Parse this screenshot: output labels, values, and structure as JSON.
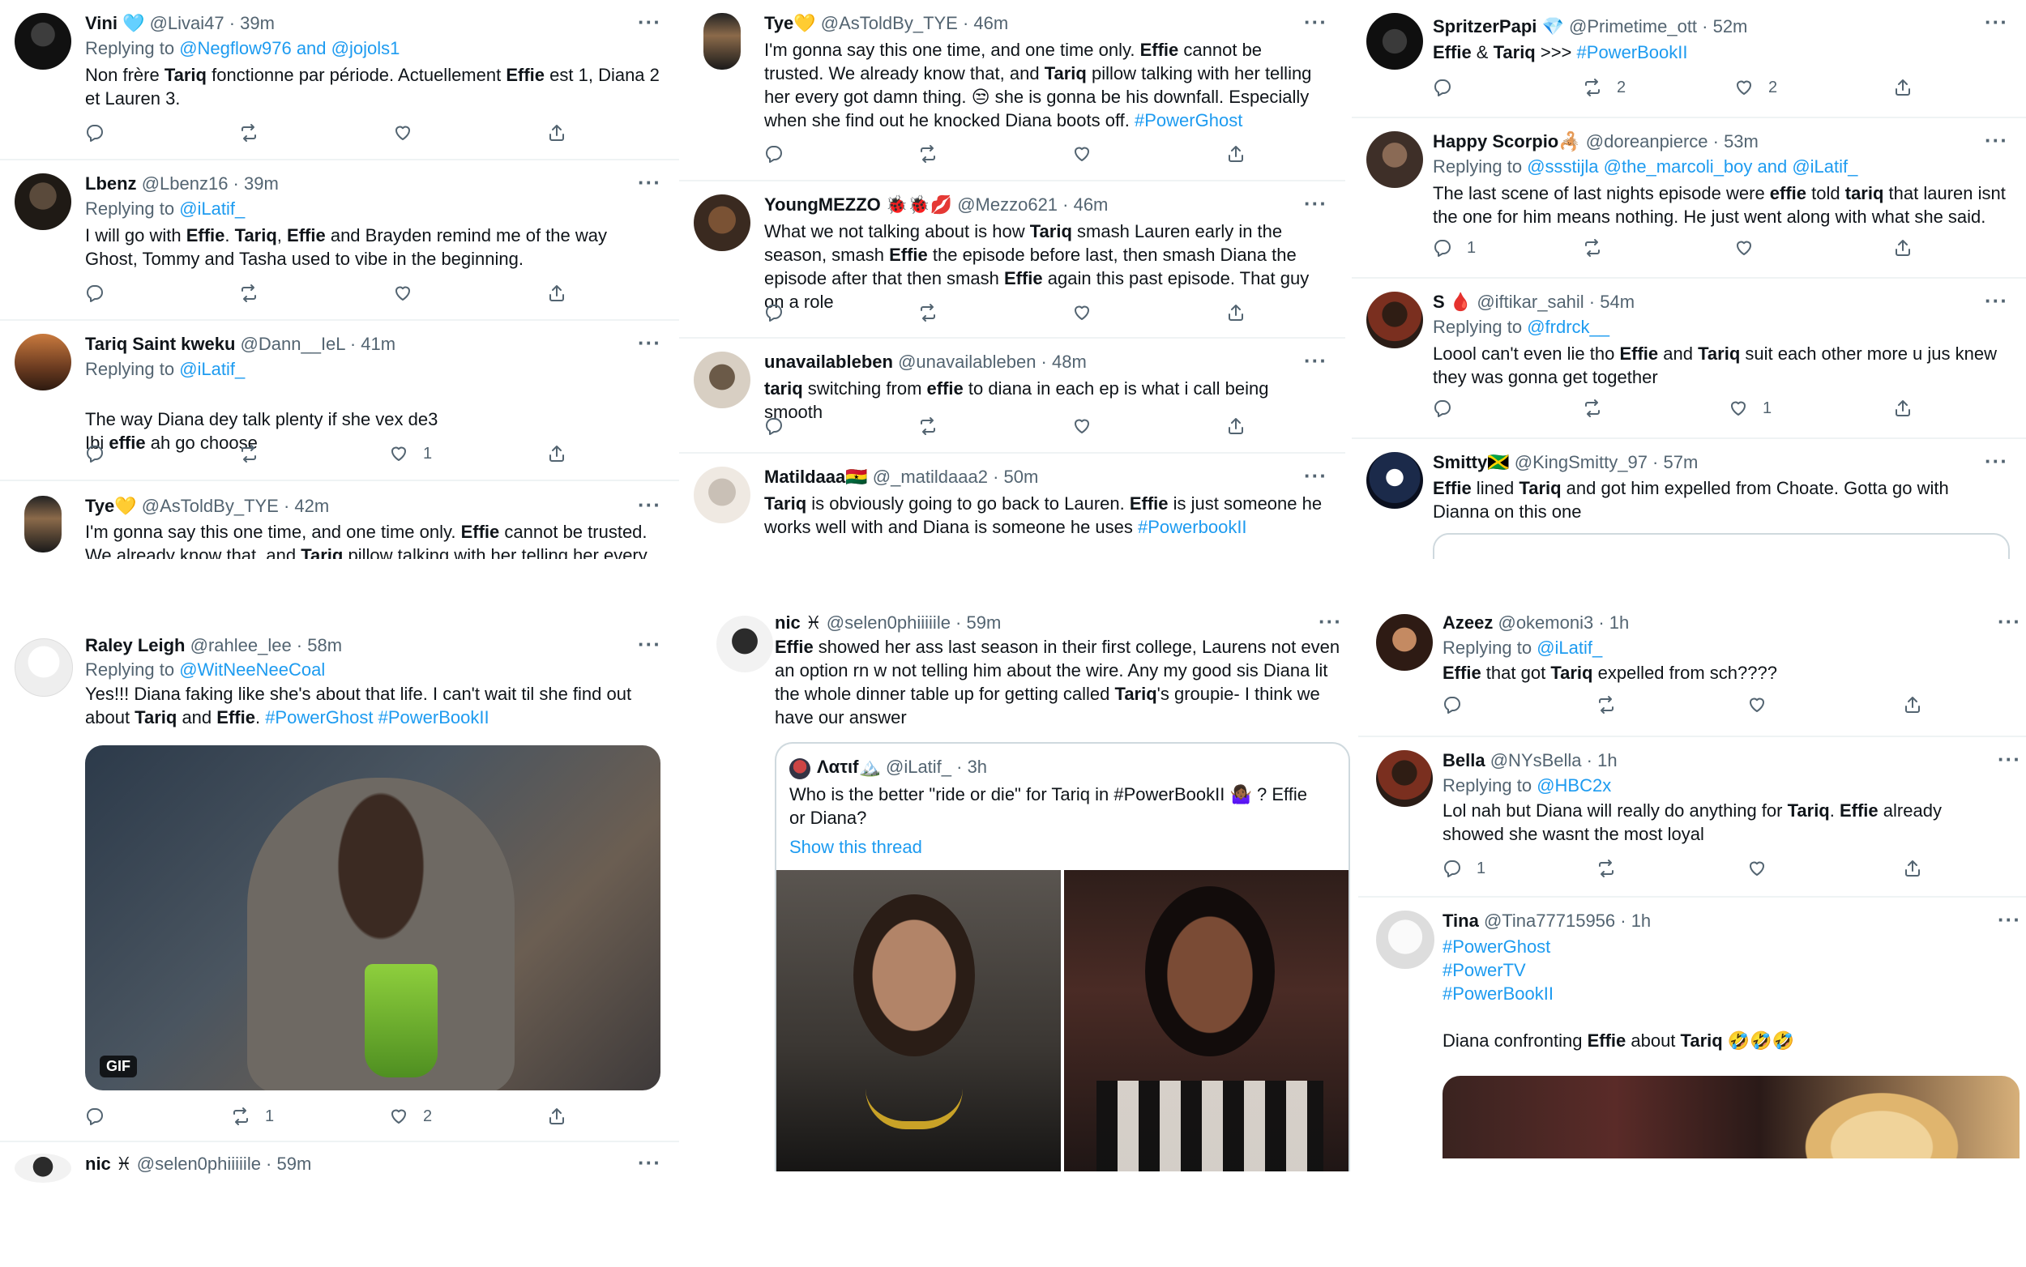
{
  "panels": {
    "p1": {
      "tweets": [
        {
          "name": "Vini 🩵",
          "handle": "@Livai47 · 39m",
          "reply_prefix": "Replying to ",
          "reply_to": "@Negflow976 and @jojols1",
          "text_parts": [
            "Non frère ",
            "Tariq",
            " fonctionne par période. Actuellement ",
            "Effie",
            " est 1, Diana 2 et Lauren 3."
          ],
          "likes": ""
        },
        {
          "name": "Lbenz",
          "handle": "@Lbenz16 · 39m",
          "reply_prefix": "Replying to ",
          "reply_to": "@iLatif_",
          "text_parts": [
            "I will go with ",
            "Effie",
            ".  ",
            "Tariq",
            ", ",
            "Effie",
            " and Brayden remind me of the way Ghost, Tommy and Tasha used to vibe in the beginning."
          ],
          "likes": ""
        },
        {
          "name": "Tariq Saint kweku",
          "handle": "@Dann__IeL · 41m",
          "reply_prefix": "Replying to ",
          "reply_to": "@iLatif_",
          "text_parts": [
            "The way Diana dey talk plenty if she vex de3\nIbi ",
            "effie",
            " ah go choose"
          ],
          "likes": "1"
        },
        {
          "name": "Tye💛",
          "handle": "@AsToldBy_TYE · 42m",
          "text_parts": [
            "I'm gonna say this one time, and one time only. ",
            "Effie",
            " cannot be trusted. We already know that, and ",
            "Tariq",
            " pillow talking with her telling her every got"
          ]
        }
      ]
    },
    "p2": {
      "tweets": [
        {
          "name": "Tye💛",
          "handle": "@AsToldBy_TYE · 46m",
          "text_parts": [
            "I'm gonna say this one time, and one time only. ",
            "Effie",
            " cannot be trusted. We already know that, and ",
            "Tariq",
            " pillow talking with her telling her every got damn thing. 😒 she is gonna be his downfall. Especially when she find out he knocked Diana boots off. "
          ],
          "hashtag": "#PowerGhost"
        },
        {
          "name": "YoungMEZZO 🐞🐞💋",
          "handle": "@Mezzo621 · 46m",
          "text_parts": [
            "What we not talking about is how ",
            "Tariq",
            " smash Lauren early in the season, smash ",
            "Effie",
            " the episode before last, then smash Diana the episode after that then smash ",
            "Effie",
            " again this past episode. That guy on a role"
          ]
        },
        {
          "name": "unavailableben",
          "handle": "@unavailableben · 48m",
          "text_parts": [
            "tariq",
            " switching from ",
            "effie",
            " to diana in each ep is what i call being smooth"
          ]
        },
        {
          "name": "Matildaaa🇬🇭",
          "handle": "@_matildaaa2 · 50m",
          "text_parts": [
            "Tariq",
            " is obviously going to go back to Lauren. ",
            "Effie",
            " is just someone he works well with and Diana is someone he uses "
          ],
          "hashtag": "#PowerbookII"
        }
      ]
    },
    "p3": {
      "tweets": [
        {
          "name": "SpritzerPapi 💎",
          "handle": "@Primetime_ott · 52m",
          "text_parts": [
            "Effie",
            " & ",
            "Tariq",
            " >>> "
          ],
          "hashtag": "#PowerBookII",
          "retweets": "2",
          "likes": "2"
        },
        {
          "name": "Happy Scorpio🦂",
          "handle": "@doreanpierce · 53m",
          "reply_prefix": "Replying to ",
          "reply_to": "@ssstijla @the_marcoli_boy and @iLatif_",
          "text_parts": [
            "The last scene of last nights episode were ",
            "effie",
            " told ",
            "tariq",
            " that lauren isnt the one for him means nothing. He just went along with what she said."
          ],
          "replies": "1"
        },
        {
          "name": "S 🩸",
          "handle": "@iftikar_sahil · 54m",
          "reply_prefix": "Replying to ",
          "reply_to": "@frdrck__",
          "text_parts": [
            "Loool can't even lie tho ",
            "Effie",
            " and ",
            "Tariq",
            " suit each other more u jus knew they was gonna get together"
          ],
          "likes": "1"
        },
        {
          "name": "Smitty🇯🇲",
          "handle": "@KingSmitty_97 · 57m",
          "text_parts": [
            "Effie",
            " lined ",
            "Tariq",
            " and got him expelled from Choate. Gotta go with Dianna on this one"
          ]
        }
      ]
    },
    "p4": {
      "tweets": [
        {
          "name": "Raley Leigh",
          "handle": "@rahlee_lee · 58m",
          "reply_prefix": "Replying to ",
          "reply_to": "@WitNeeNeeCoal",
          "text_parts": [
            "Yes!!! Diana faking like she's about that life. I can't wait til she find out about ",
            "Tariq",
            " and ",
            "Effie",
            ". "
          ],
          "hashtag": "#PowerGhost",
          "hashtag2": "#PowerBookII",
          "gif_label": "GIF",
          "retweets": "1",
          "likes": "2"
        },
        {
          "name": "nic ♓︎",
          "handle": "@selen0phiiiiile · 59m"
        }
      ]
    },
    "p5": {
      "tweet": {
        "name": "nic ♓︎",
        "handle": "@selen0phiiiiile · 59m",
        "text_parts": [
          "Effie",
          " showed her ass last season in their first college, Laurens not even an option rn w not telling him about the wire. Any my good sis Diana lit the whole dinner table up for getting called ",
          "Tariq",
          "'s groupie- I think we have our answer"
        ]
      },
      "quote": {
        "name": "Λατιf🏔️",
        "handle": "@iLatif_ · 3h",
        "text": "Who is the better \"ride or die\" for Tariq in #PowerBookII 🤷🏾‍♀️ ? Effie or Diana?",
        "link": "Show this thread"
      }
    },
    "p6": {
      "tweets": [
        {
          "name": "Azeez",
          "handle": "@okemoni3 · 1h",
          "reply_prefix": "Replying to ",
          "reply_to": "@iLatif_",
          "text_parts": [
            "Effie",
            " that got ",
            "Tariq",
            " expelled from sch????"
          ]
        },
        {
          "name": "Bella",
          "handle": "@NYsBella · 1h",
          "reply_prefix": "Replying to ",
          "reply_to": "@HBC2x",
          "text_parts": [
            "Lol nah but Diana will really do anything for ",
            "Tariq",
            ". ",
            "Effie",
            " already showed she wasnt the most loyal"
          ],
          "replies": "1"
        },
        {
          "name": "Tina",
          "handle": "@Tina77715956 · 1h",
          "hashtags": [
            "#PowerGhost",
            "#PowerTV",
            "#PowerBookII"
          ],
          "text_parts": [
            "Diana confronting ",
            "Effie",
            " about ",
            "Tariq",
            " 🤣🤣🤣"
          ]
        }
      ]
    }
  },
  "ui": {
    "more": "···",
    "lauren_stub": "Λατιf🏔️ @iLatif_ · 3h"
  },
  "icons": [
    "reply-icon",
    "retweet-icon",
    "like-icon",
    "share-icon",
    "more-icon"
  ]
}
